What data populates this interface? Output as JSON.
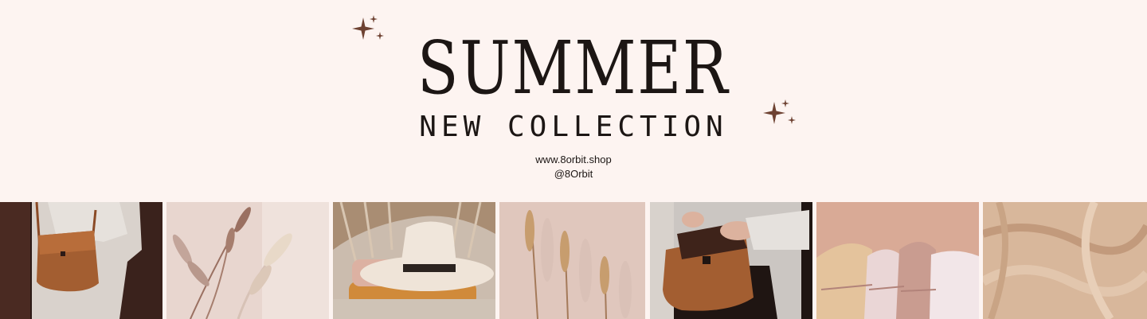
{
  "header": {
    "title": "SUMMER",
    "subtitle": "NEW COLLECTION",
    "website": "www.8orbit.shop",
    "handle": "@8Orbit"
  },
  "colors": {
    "background": "#fdf4f1",
    "text": "#1c1614",
    "sparkle": "#6e4232"
  },
  "icons": [
    "sparkle-icon"
  ],
  "photos": [
    {
      "name": "photo-leather-crossbody-bag"
    },
    {
      "name": "photo-dried-grass-shadow"
    },
    {
      "name": "photo-hat-on-sweaters"
    },
    {
      "name": "photo-dried-wheat-stems"
    },
    {
      "name": "photo-hands-opening-bag"
    },
    {
      "name": "photo-folded-clothes"
    },
    {
      "name": "photo-beige-fabric"
    }
  ]
}
